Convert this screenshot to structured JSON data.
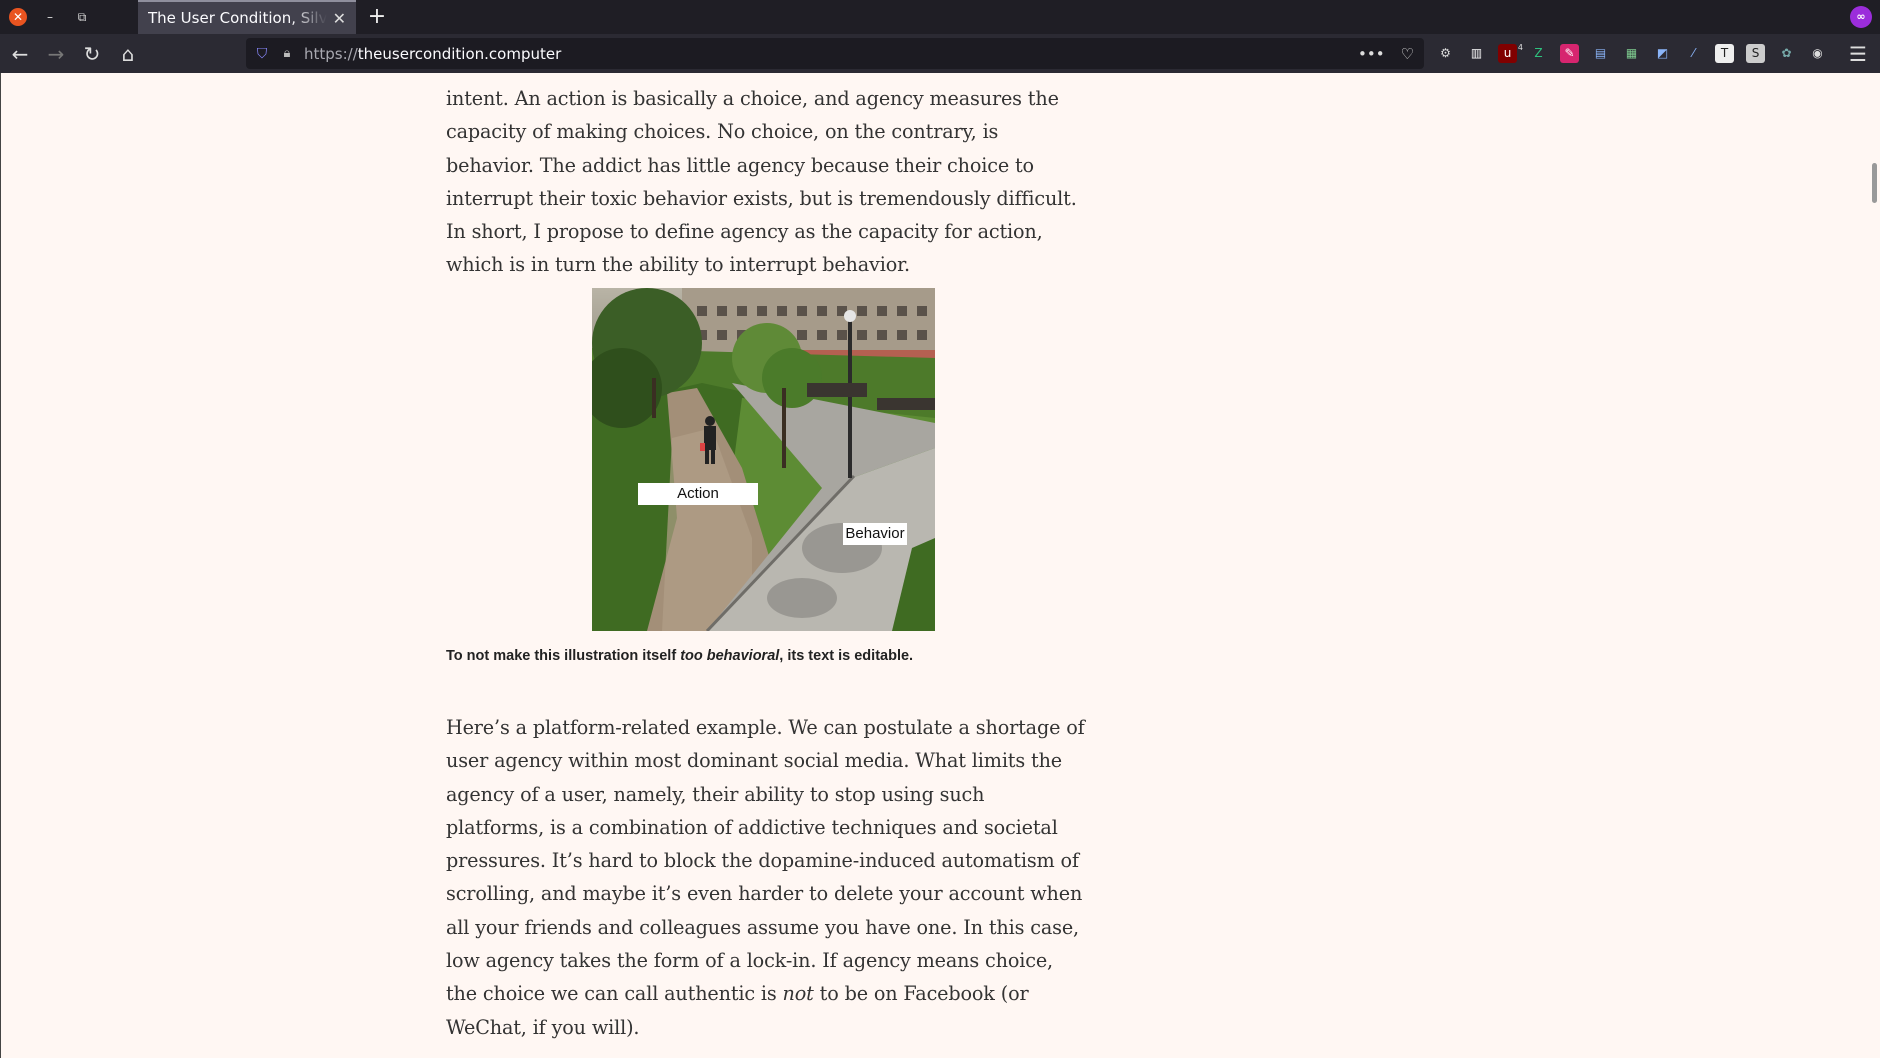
{
  "browser": {
    "tab_title": "The User Condition, Silvio Lorusso",
    "url_protocol": "https://",
    "url_host": "theusercondition.computer",
    "new_tab_symbol": "+",
    "tab_close_symbol": "✕",
    "extensions": [
      {
        "name": "gear-extension-icon",
        "glyph": "⚙",
        "color": "#dddddd",
        "bg": "transparent"
      },
      {
        "name": "library-extension-icon",
        "glyph": "▥",
        "color": "#ffffff",
        "bg": "transparent"
      },
      {
        "name": "ublock-extension-icon",
        "glyph": "u",
        "color": "#ffffff",
        "bg": "#800000",
        "badge": "4"
      },
      {
        "name": "green-z-extension-icon",
        "glyph": "Z",
        "color": "#2ec27e",
        "bg": "transparent"
      },
      {
        "name": "pink-extension-icon",
        "glyph": "✎",
        "color": "#ffffff",
        "bg": "#d6256f"
      },
      {
        "name": "document-extension-icon",
        "glyph": "▤",
        "color": "#8ab4f8",
        "bg": "transparent"
      },
      {
        "name": "sheet-extension-icon",
        "glyph": "▦",
        "color": "#7ecb8f",
        "bg": "transparent"
      },
      {
        "name": "picture-extension-icon",
        "glyph": "◩",
        "color": "#8ab4f8",
        "bg": "transparent"
      },
      {
        "name": "pen-extension-icon",
        "glyph": "⁄",
        "color": "#8ab4f8",
        "bg": "transparent"
      },
      {
        "name": "tile-extension-icon",
        "glyph": "T",
        "color": "#222222",
        "bg": "#eeeeee"
      },
      {
        "name": "s-extension-icon",
        "glyph": "S",
        "color": "#222222",
        "bg": "#cccccc"
      },
      {
        "name": "flower-extension-icon",
        "glyph": "✿",
        "color": "#7aa",
        "bg": "transparent"
      },
      {
        "name": "account-icon",
        "glyph": "◉",
        "color": "#dddddd",
        "bg": "transparent"
      }
    ]
  },
  "article": {
    "para1": "intent. An action is basically a choice, and agency measures the capacity of making choices. No choice, on the contrary, is behavior. The addict has little agency because their choice to interrupt their toxic behavior exists, but is tremendously difficult. In short, I propose to define agency as the capacity for action, which is in turn the ability to interrupt behavior.",
    "figure": {
      "label_action": "Action",
      "label_behavior": "Behavior"
    },
    "caption": {
      "before": "To not make this illustration itself ",
      "emphasis": "too behavioral",
      "after": ", its text is editable."
    },
    "para2": {
      "before": "Here’s a platform-related example. We can postulate a shortage of user agency within most dominant social media. What limits the agency of a user, namely, their ability to stop using such platforms, is a combination of addictive techniques and societal pressures. It’s hard to block the dopamine-induced automatism of scrolling, and maybe it’s even harder to delete your account when all your friends and colleagues assume you have one. In this case, low agency takes the form of a lock-in. If agency means choice, the choice we can call authentic is ",
      "emphasis": "not",
      "after": " to be on Facebook (or WeChat, if you will)."
    }
  }
}
